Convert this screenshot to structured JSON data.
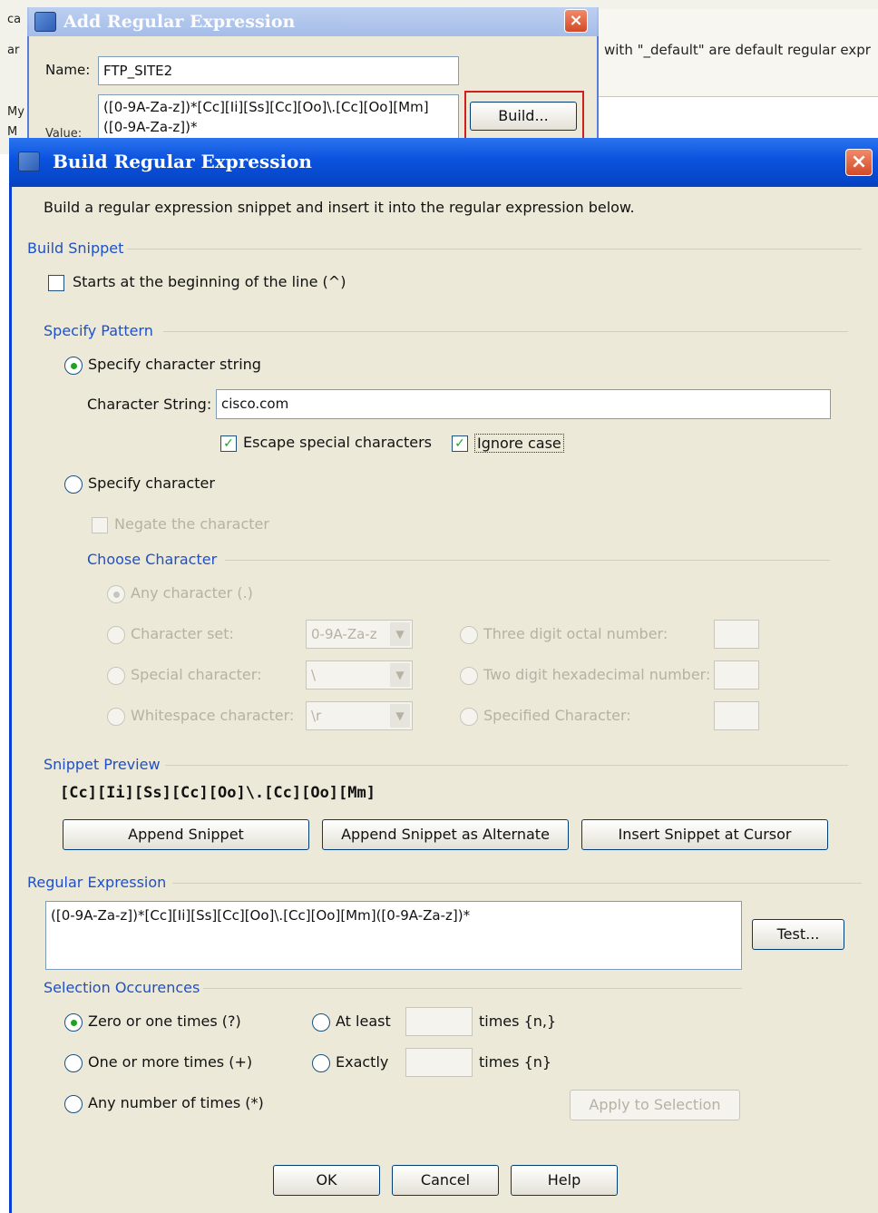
{
  "background_window": {
    "info_text": "with \"_default\" are default regular expr",
    "left_fragments": [
      "ca",
      "ar",
      "My",
      "M"
    ]
  },
  "add_dialog": {
    "title": "Add Regular Expression",
    "name_label": "Name:",
    "name_value": "FTP_SITE2",
    "value_label": "Value:",
    "value_line1": "([0-9A-Za-z])*[Cc][Ii][Ss][Cc][Oo]\\.[Cc][Oo][Mm]",
    "value_line2": "([0-9A-Za-z])*",
    "build_button": "Build...",
    "close_glyph": "×"
  },
  "build_dialog": {
    "title": "Build Regular Expression",
    "close_glyph": "×",
    "description": "Build a regular expression snippet and insert it into the regular expression below.",
    "build_snippet": {
      "group_label": "Build Snippet",
      "starts_beginning_label": "Starts at the beginning of the line (^)",
      "starts_beginning_checked": false
    },
    "specify_pattern": {
      "group_label": "Specify Pattern",
      "char_string_radio": "Specify character string",
      "char_string_selected": true,
      "char_string_label": "Character String:",
      "char_string_value": "cisco.com",
      "escape_label": "Escape special characters",
      "escape_checked": true,
      "ignore_case_label": "Ignore case",
      "ignore_case_checked": true,
      "specify_character_radio": "Specify character",
      "specify_character_selected": false,
      "negate_label": "Negate the character"
    },
    "choose_character": {
      "group_label": "Choose Character",
      "any_character": "Any character (.)",
      "character_set": "Character set:",
      "character_set_value": "0-9A-Za-z",
      "special_character": "Special character:",
      "special_character_value": "\\",
      "whitespace_character": "Whitespace character:",
      "whitespace_character_value": "\\r",
      "three_digit_octal": "Three digit octal number:",
      "two_digit_hex": "Two digit hexadecimal number:",
      "specified_character": "Specified Character:"
    },
    "snippet_preview": {
      "group_label": "Snippet Preview",
      "value": "[Cc][Ii][Ss][Cc][Oo]\\.[Cc][Oo][Mm]",
      "append_button": "Append Snippet",
      "append_alternate_button": "Append Snippet as Alternate",
      "insert_button": "Insert Snippet at Cursor"
    },
    "regular_expression": {
      "group_label": "Regular Expression",
      "value": "([0-9A-Za-z])*[Cc][Ii][Ss][Cc][Oo]\\.[Cc][Oo][Mm]([0-9A-Za-z])*",
      "test_button": "Test..."
    },
    "selection_occurrences": {
      "group_label": "Selection Occurences",
      "zero_or_one": "Zero or one times (?)",
      "zero_or_one_selected": true,
      "one_or_more": "One or more times (+)",
      "any_number": "Any number of times (*)",
      "at_least": "At least",
      "at_least_suffix": "times {n,}",
      "exactly": "Exactly",
      "exactly_suffix": "times {n}",
      "apply_button": "Apply to Selection"
    },
    "footer": {
      "ok_button": "OK",
      "cancel_button": "Cancel",
      "help_button": "Help"
    }
  },
  "colors": {
    "titlebar_blue": "#0a52dd",
    "group_label_blue": "#1e50c8",
    "dialog_bg": "#ece9d8",
    "highlight_red": "#d11f1f",
    "check_green": "#21a121"
  }
}
